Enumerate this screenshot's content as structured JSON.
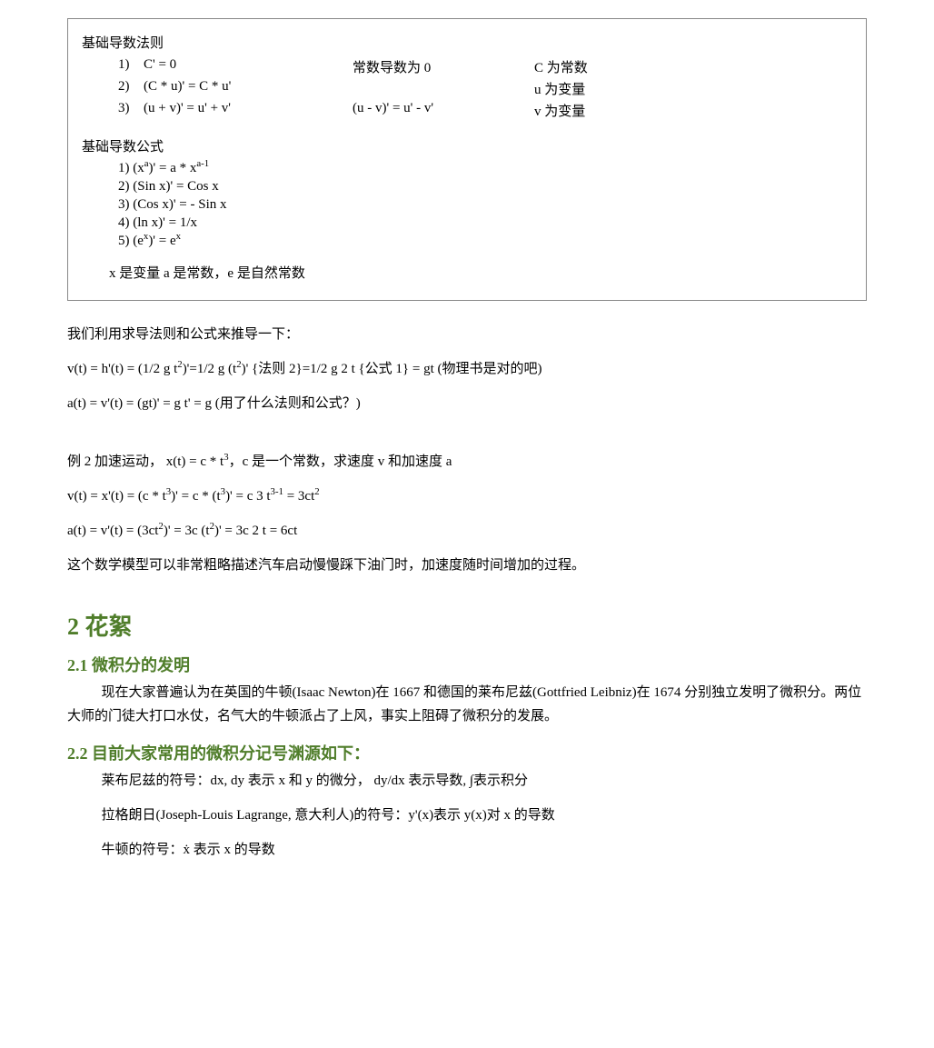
{
  "box": {
    "title1": "基础导数法则",
    "rules": [
      {
        "num": "1)",
        "expr": "C' = 0",
        "expr2": "常数导数为 0",
        "note": "C 为常数"
      },
      {
        "num": "2)",
        "expr": "(C * u)' = C * u'",
        "expr2": "",
        "note": "u 为变量"
      },
      {
        "num": "3)",
        "expr": "(u + v)' = u' + v'",
        "expr2": "(u - v)' = u' - v'",
        "note": "v 为变量"
      }
    ],
    "title2": "基础导数公式",
    "formulas": [
      {
        "num": "1)",
        "html": "(x<sup>a</sup>)' = a * x<sup>a-1</sup>"
      },
      {
        "num": "2)",
        "html": "(Sin x)' = Cos x"
      },
      {
        "num": "3)",
        "html": "(Cos x)' = - Sin x"
      },
      {
        "num": "4)",
        "html": "(ln x)' = 1/x"
      },
      {
        "num": "5)",
        "html": "(e<sup>x</sup>)' = e<sup>x</sup>"
      }
    ],
    "footer": "x 是变量 a 是常数，e 是自然常数"
  },
  "body": {
    "p1": "我们利用求导法则和公式来推导一下：",
    "p2_html": "v(t) = h'(t) = (1/2 g t<sup>2</sup>)'=1/2 g (t<sup>2</sup>)'  {法则 2}=1/2 g 2 t  {公式 1} = gt (物理书是对的吧)",
    "p3": "a(t) = v'(t) = (gt)' = g t' = g   (用了什么法则和公式？)",
    "p4_html": "例 2 加速运动， x(t) = c * t<sup>3</sup>，c 是一个常数，求速度 v 和加速度 a",
    "p5_html": "v(t) = x'(t) = (c * t<sup>3</sup>)' = c * (t<sup>3</sup>)' = c 3 t<sup>3-1</sup> = 3ct<sup>2</sup>",
    "p6_html": "a(t) = v'(t) = (3ct<sup>2</sup>)' = 3c (t<sup>2</sup>)' = 3c 2 t = 6ct",
    "p7": "这个数学模型可以非常粗略描述汽车启动慢慢踩下油门时，加速度随时间增加的过程。"
  },
  "sections": {
    "s2": "2  花絮",
    "s21": "2.1  微积分的发明",
    "s21_text": "现在大家普遍认为在英国的牛顿(Isaac Newton)在 1667 和德国的莱布尼兹(Gottfried Leibniz)在 1674 分别独立发明了微积分。两位大师的门徒大打口水仗，名气大的牛顿派占了上风，事实上阻碍了微积分的发展。",
    "s22": "2.2  目前大家常用的微积分记号渊源如下：",
    "s22_items": [
      "莱布尼兹的符号：dx, dy 表示 x 和 y 的微分， dy/dx 表示导数, ∫表示积分",
      "拉格朗日(Joseph-Louis Lagrange, 意大利人)的符号：y'(x)表示 y(x)对 x 的导数",
      "牛顿的符号：ẋ 表示 x 的导数"
    ]
  }
}
